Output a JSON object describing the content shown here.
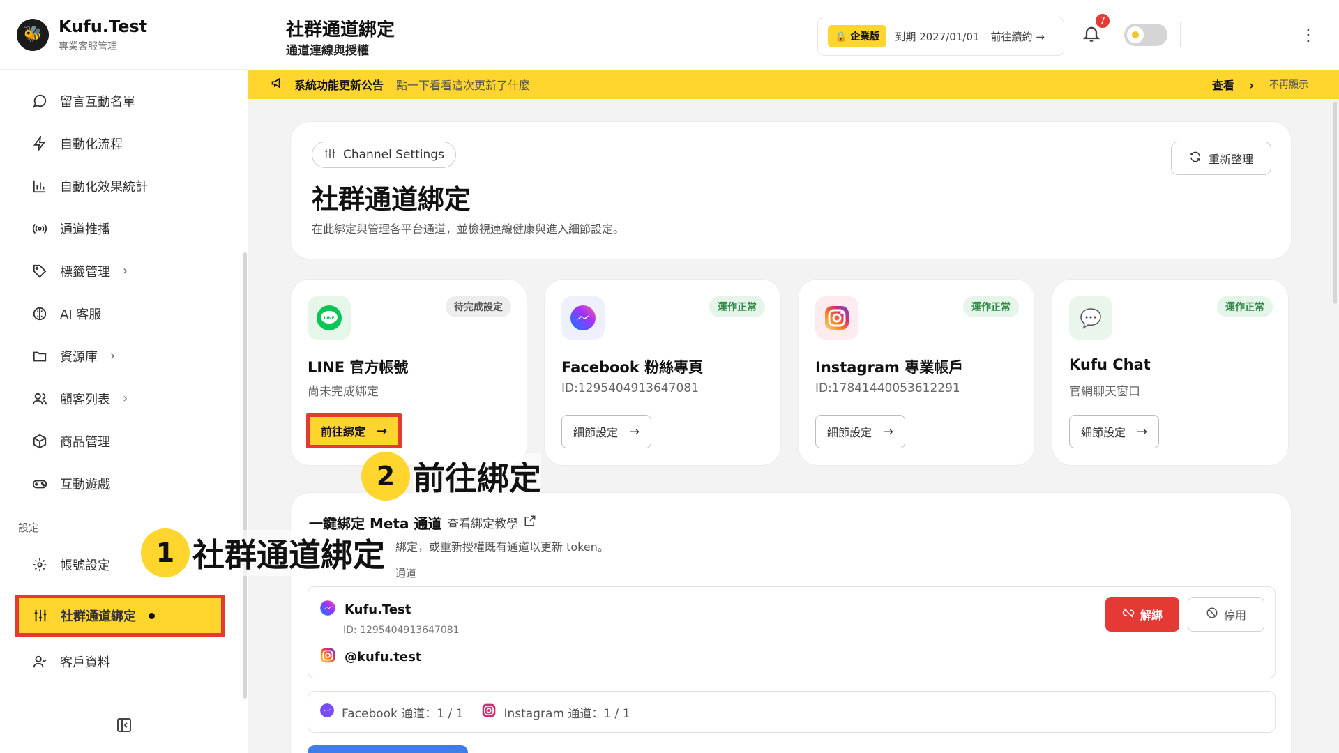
{
  "brand": {
    "name": "Kufu.Test",
    "subtitle": "專業客服管理"
  },
  "sidebar": {
    "items": [
      {
        "label": "留言互動名單",
        "icon": "chat-bubble-icon"
      },
      {
        "label": "自動化流程",
        "icon": "lightning-icon"
      },
      {
        "label": "自動化效果統計",
        "icon": "bar-chart-icon"
      },
      {
        "label": "通道推播",
        "icon": "broadcast-icon"
      },
      {
        "label": "標籤管理",
        "icon": "tag-icon"
      },
      {
        "label": "AI 客服",
        "icon": "ai-brain-icon"
      },
      {
        "label": "資源庫",
        "icon": "folder-icon"
      },
      {
        "label": "顧客列表",
        "icon": "users-icon"
      },
      {
        "label": "商品管理",
        "icon": "box-icon"
      },
      {
        "label": "互動遊戲",
        "icon": "gamepad-icon"
      }
    ],
    "section_settings": "設定",
    "settings_items": [
      {
        "label": "帳號設定",
        "icon": "gear-icon"
      },
      {
        "label": "社群通道綁定",
        "icon": "sliders-icon"
      },
      {
        "label": "客戶資料",
        "icon": "user-icon"
      }
    ]
  },
  "header": {
    "title": "社群通道綁定",
    "subtitle": "通道連線與授權",
    "plan_badge": "企業版",
    "plan_expiry": "到期 2027/01/01",
    "plan_renew": "前往續約 →",
    "notif_count": "7"
  },
  "announcement": {
    "title": "系統功能更新公告",
    "text": "點一下看看這次更新了什麼",
    "view": "查看",
    "hide": "不再顯示"
  },
  "intro": {
    "pill": "Channel Settings",
    "title": "社群通道綁定",
    "desc": "在此綁定與管理各平台通道，並檢視連線健康與進入細節設定。",
    "refresh": "重新整理"
  },
  "channels": [
    {
      "name": "LINE 官方帳號",
      "sub": "尚未完成綁定",
      "status": "待完成設定",
      "button": "前往綁定"
    },
    {
      "name": "Facebook 粉絲專頁",
      "sub": "ID:1295404913647081",
      "status": "運作正常",
      "button": "細節設定"
    },
    {
      "name": "Instagram 專業帳戶",
      "sub": "ID:17841440053612291",
      "status": "運作正常",
      "button": "細節設定"
    },
    {
      "name": "Kufu Chat",
      "sub": "官網聊天窗口",
      "status": "運作正常",
      "button": "細節設定"
    }
  ],
  "meta": {
    "title": "一鍵綁定 Meta 通道",
    "tutorial": "查看綁定教學",
    "desc": "綁定，或重新授權既有通道以更新 token。",
    "label": "通道",
    "account_name": "Kufu.Test",
    "account_id": "ID: 1295404913647081",
    "ig_handle": "@kufu.test",
    "unbind": "解綁",
    "disable": "停用",
    "fb_summary": "Facebook 通道：1 / 1",
    "ig_summary": "Instagram 通道：1 / 1"
  },
  "callouts": {
    "one_num": "1",
    "one_text": "社群通道綁定",
    "two_num": "2",
    "two_text": "前往綁定"
  },
  "colors": {
    "accent": "#ffd52e",
    "highlight_border": "#e63a30",
    "danger": "#e53935",
    "ok": "#2e8b47"
  }
}
